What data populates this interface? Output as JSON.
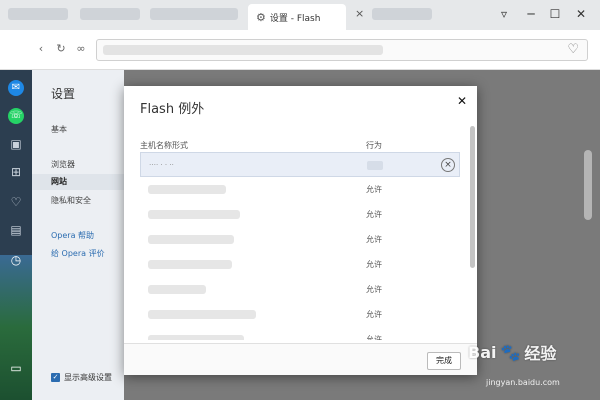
{
  "browser": {
    "active_tab_title": "设置 - Flash",
    "close_glyph": "×",
    "minimize_glyph": "─",
    "maximize_glyph": "☐",
    "close_window_glyph": "✕",
    "menu_glyph": "▿"
  },
  "sidebar": {
    "title": "设置",
    "items": [
      {
        "label": "基本"
      },
      {
        "label": "浏览器"
      },
      {
        "label": "网站"
      },
      {
        "label": "隐私和安全"
      }
    ],
    "links": [
      {
        "label": "Opera 帮助"
      },
      {
        "label": "给 Opera 评价"
      }
    ],
    "advanced_label": "显示高级设置"
  },
  "dialog": {
    "title": "Flash 例外",
    "close_glyph": "✕",
    "columns": {
      "host": "主机名称形式",
      "action": "行为"
    },
    "rows": [
      {
        "host": "…. . . ..",
        "action": "",
        "selected": true
      },
      {
        "host": "",
        "action": "允许"
      },
      {
        "host": "",
        "action": "允许"
      },
      {
        "host": "",
        "action": "允许"
      },
      {
        "host": "",
        "action": "允许"
      },
      {
        "host": "",
        "action": "允许"
      },
      {
        "host": "",
        "action": "允许"
      },
      {
        "host": "",
        "action": "允许"
      }
    ],
    "remove_glyph": "×",
    "done_label": "完成"
  },
  "watermark": {
    "brand": "Bai",
    "brand2": "经验",
    "url": "jingyan.baidu.com"
  },
  "colors": {
    "link": "#2b6cb0",
    "rail": "#2c3e50",
    "desktop": "#1e5ea8"
  }
}
